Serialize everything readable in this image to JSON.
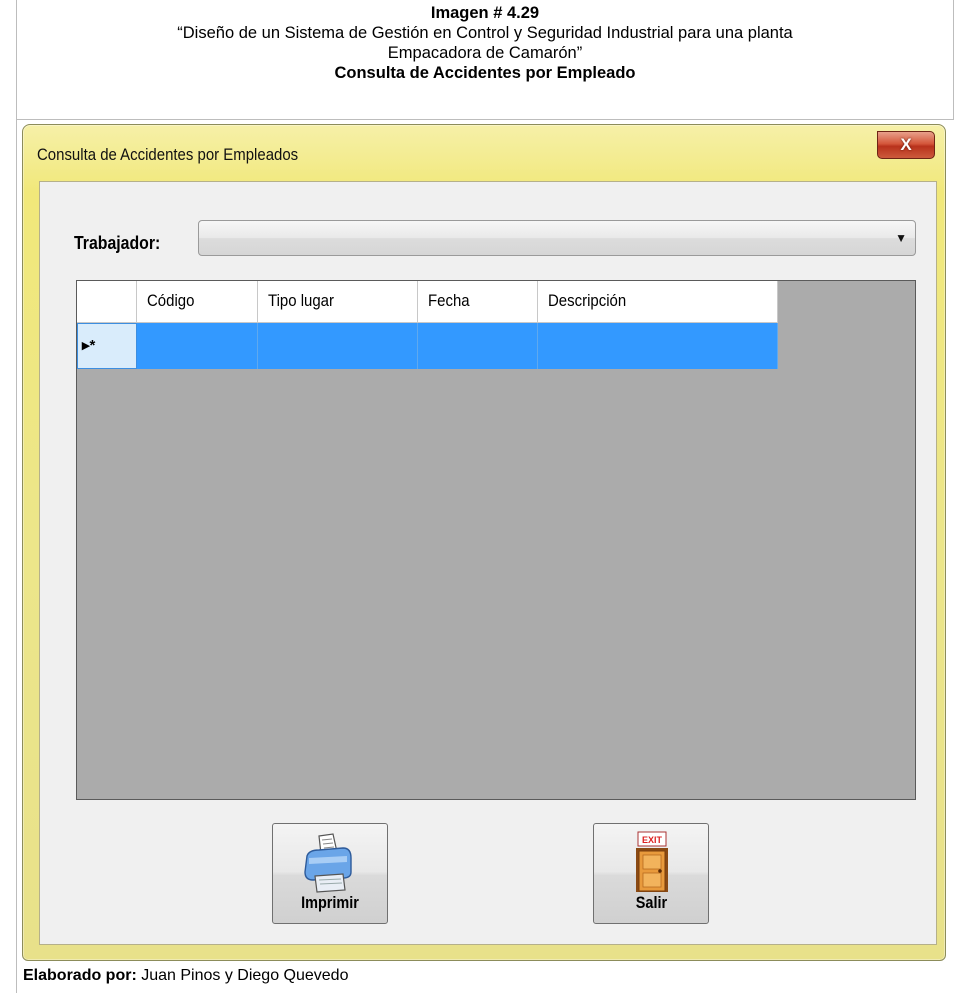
{
  "caption": {
    "line1": "Imagen # 4.29",
    "line2": "“Diseño de un Sistema de Gestión en Control y Seguridad Industrial para una planta",
    "line3": "Empacadora de Camarón”",
    "line4": "Consulta de Accidentes por Empleado"
  },
  "window": {
    "title": "Consulta de Accidentes por Empleados",
    "close_label": "X"
  },
  "form": {
    "trabajador_label": "Trabajador:",
    "trabajador_value": ""
  },
  "grid": {
    "columns": [
      "Código",
      "Tipo lugar",
      "Fecha",
      "Descripción"
    ],
    "new_row_marker": "▸*",
    "rows": [
      [
        "",
        "",
        "",
        ""
      ]
    ]
  },
  "buttons": {
    "imprimir": "Imprimir",
    "salir": "Salir",
    "exit_sign": "EXIT"
  },
  "footer": {
    "label": "Elaborado por:",
    "authors": " Juan Pinos y Diego Quevedo"
  }
}
